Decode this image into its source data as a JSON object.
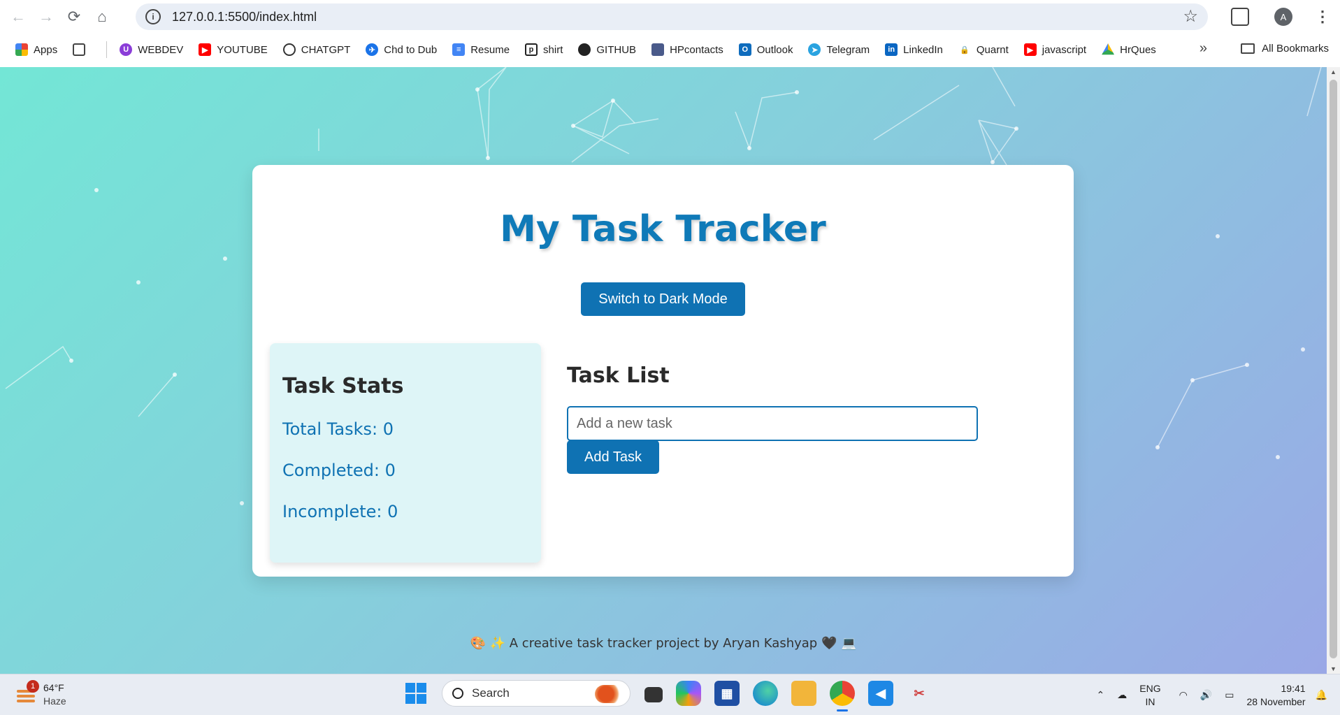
{
  "browser": {
    "url": "127.0.0.1:5500/index.html",
    "profile_initial": "A",
    "bookmarks": [
      {
        "label": "Apps",
        "icon": "apps-grid-icon",
        "color": "#ea4335"
      },
      {
        "label": "",
        "icon": "tab-groups-icon",
        "color": "#444444"
      },
      {
        "label": "WEBDEV",
        "icon": "webdev-icon",
        "color": "#8b3dd8"
      },
      {
        "label": "YOUTUBE",
        "icon": "youtube-icon",
        "color": "#ff0000"
      },
      {
        "label": "CHATGPT",
        "icon": "chatgpt-icon",
        "color": "#333333"
      },
      {
        "label": "Chd to Dub",
        "icon": "flight-icon",
        "color": "#1a73e8"
      },
      {
        "label": "Resume",
        "icon": "docs-icon",
        "color": "#4285f4"
      },
      {
        "label": "shirt",
        "icon": "shirt-icon",
        "color": "#222222"
      },
      {
        "label": "GITHUB",
        "icon": "github-icon",
        "color": "#222222"
      },
      {
        "label": "HPcontacts",
        "icon": "hpcontacts-icon",
        "color": "#4a5a8a"
      },
      {
        "label": "Outlook",
        "icon": "outlook-icon",
        "color": "#0f6cbd"
      },
      {
        "label": "Telegram",
        "icon": "telegram-icon",
        "color": "#2aa3e0"
      },
      {
        "label": "LinkedIn",
        "icon": "linkedin-icon",
        "color": "#0a66c2"
      },
      {
        "label": "Quarnt",
        "icon": "lock-icon",
        "color": "#666666"
      },
      {
        "label": "javascript",
        "icon": "youtube-icon",
        "color": "#ff0000"
      },
      {
        "label": "HrQues",
        "icon": "drive-icon",
        "color": "#34a853"
      }
    ],
    "all_bookmarks": "All Bookmarks"
  },
  "page": {
    "title": "My Task Tracker",
    "dark_mode_button": "Switch to Dark Mode",
    "stats": {
      "heading": "Task Stats",
      "total": "Total Tasks: 0",
      "completed": "Completed: 0",
      "incomplete": "Incomplete: 0"
    },
    "task_list": {
      "heading": "Task List",
      "input_placeholder": "Add a new task",
      "add_button": "Add Task"
    },
    "footer": "🎨 ✨ A creative task tracker project by Aryan Kashyap 🖤 💻"
  },
  "taskbar": {
    "weather_temp": "64°F",
    "weather_desc": "Haze",
    "weather_badge": "1",
    "search_label": "Search",
    "lang_top": "ENG",
    "lang_bottom": "IN",
    "time": "19:41",
    "date": "28 November"
  }
}
